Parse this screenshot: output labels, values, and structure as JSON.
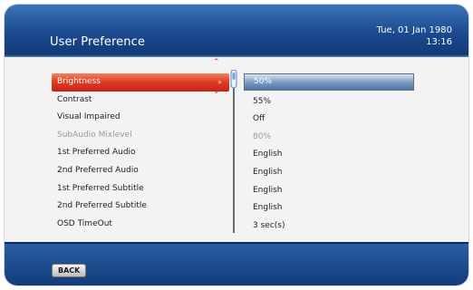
{
  "header": {
    "title": "User Preference",
    "date": "Tue, 01 Jan 1980",
    "time": "13:16"
  },
  "settings": [
    {
      "label": "Brightness",
      "value": "50%"
    },
    {
      "label": "Contrast",
      "value": "55%"
    },
    {
      "label": "Visual Impaired",
      "value": "Off"
    },
    {
      "label": "SubAudio Mixlevel",
      "value": "80%"
    },
    {
      "label": "1st Preferred Audio",
      "value": "English"
    },
    {
      "label": "2nd Preferred Audio",
      "value": "English"
    },
    {
      "label": "1st Preferred Subtitle",
      "value": "English"
    },
    {
      "label": "2nd Preferred Subtitle",
      "value": "English"
    },
    {
      "label": "OSD TimeOut",
      "value": "3 sec(s)"
    }
  ],
  "footer": {
    "back_label": "BACK"
  },
  "colors": {
    "selection": "#e23c22",
    "header_blue": "#1c4b91",
    "disabled_text": "#9a9a9a"
  },
  "icons": {
    "scroll_up": "chevron-up-icon",
    "scroll_down": "chevron-down-icon",
    "selection_arrow": "double-arrow-right-icon",
    "slider_marker": "slider-marker-icon"
  }
}
